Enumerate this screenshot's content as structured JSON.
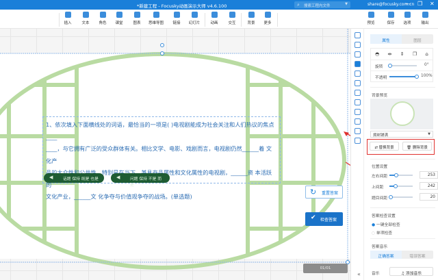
{
  "titlebar": {
    "title": "*新建工程 - Focusky动画演示大师  v4.6.100",
    "search_placeholder": "搜索工程内文件",
    "user": "share@focusky.com.cn",
    "minimize": "—",
    "restore": "❐",
    "close": "✕"
  },
  "toolbar": {
    "items": [
      "插入",
      "文本",
      "角色",
      "课堂",
      "图表",
      "思维导图",
      "链接",
      "幻灯片",
      "动画",
      "交互",
      "背景",
      "更多"
    ],
    "right": [
      "预览",
      "保存",
      "选项",
      "输出"
    ]
  },
  "question": {
    "line1": "1、依次填入下面横线处的词语，最恰当的一项是( )电视剧能成为社会关注和人们热议的焦点____",
    "line2": "____，与它拥有广泛的受众群体有关。相比文学、电影、戏剧而言，电视剧仍然______着 文化产",
    "line3": "品的大众性和公共性。特别是在当下，兼具商品属性和文化属性的电视剧，______资 本活跃的",
    "line4": "文化产业，______文 化争夺与价值观争夺的战场。(单选题)",
    "options": [
      "话题 保持 既是 也是",
      "问题 保持 不是 而是"
    ]
  },
  "buttons": {
    "reset": "重置答案",
    "check": "检查答案"
  },
  "pager": {
    "text": "01/01"
  },
  "panel": {
    "tabs": [
      "属性",
      "图层"
    ],
    "rotate_label": "旋转",
    "rotate_value": "0°",
    "rotate": 0,
    "opacity_label": "不透明",
    "opacity_value": "100%",
    "opacity": 100,
    "bg_preview": "背景预览",
    "fill_mode": "拥剃铺满",
    "replace_bg": "替换背景",
    "delete_bg": "删除背景",
    "position_title": "位置设置",
    "lr_label": "左右间距",
    "lr_value": "253",
    "tb_label": "上间距",
    "tb_value": "242",
    "opt_label": "题目间距",
    "opt_value": "20",
    "check_title": "答案检查设置",
    "check_opts": [
      "一键全部检查",
      "单项检查"
    ],
    "music_title": "答案音乐",
    "music_tabs": [
      "正确答案",
      "错误答案"
    ],
    "music_label": "音乐",
    "add_music": "添加音乐",
    "collapse": "«"
  },
  "colors": {
    "accent": "#1a7fd9",
    "green": "#b9dba2",
    "pill": "#1e5c33",
    "highlight": "#e0312e"
  }
}
